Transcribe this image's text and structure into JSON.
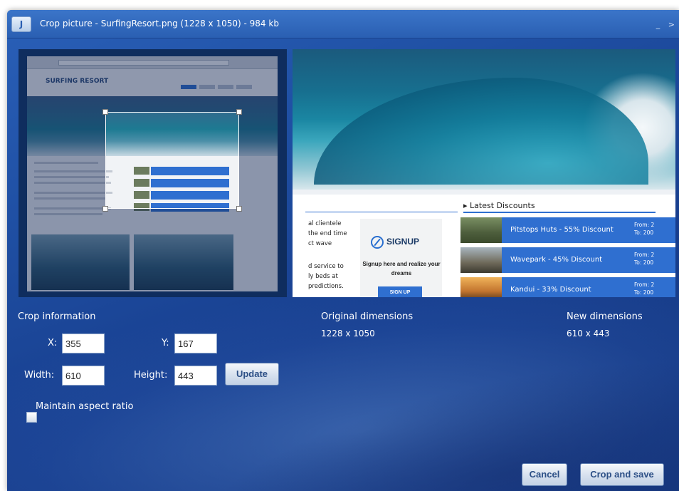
{
  "window": {
    "app_icon_letter": "J",
    "title": "Crop picture - SurfingResort.png  (1228 x 1050)  -  984 kb",
    "controls": "_ >"
  },
  "preview": {
    "site_logo": "SURFING RESORT",
    "latest_discounts": "Latest Discounts",
    "snippet_lines": [
      "al clientele",
      "the end time",
      "ct wave",
      "d service to",
      "ly beds at",
      "predictions."
    ],
    "signup_logo_text": "SIGNUP",
    "signup_tagline": "Signup here and realize your dreams",
    "signup_button": "SIGN UP",
    "deals": [
      {
        "name": "Pitstops Huts - 55% Discount",
        "from": "From: 2",
        "to": "To: 200"
      },
      {
        "name": "Wavepark - 45% Discount",
        "from": "From: 2",
        "to": "To: 200"
      },
      {
        "name": "Kandui - 33% Discount",
        "from": "From: 2",
        "to": "To: 200"
      }
    ]
  },
  "crop_info": {
    "heading": "Crop information",
    "x_label": "X:",
    "x_value": "355",
    "y_label": "Y:",
    "y_value": "167",
    "width_label": "Width:",
    "width_value": "610",
    "height_label": "Height:",
    "height_value": "443",
    "update_button": "Update",
    "aspect_label": "Maintain aspect ratio",
    "aspect_checked": false
  },
  "original": {
    "heading": "Original dimensions",
    "value": "1228 x 1050"
  },
  "new_dims": {
    "heading": "New dimensions",
    "value": "610 x 443"
  },
  "actions": {
    "cancel": "Cancel",
    "crop_save": "Crop and save"
  },
  "colors": {
    "dialog_blue": "#1f4fa3",
    "accent_blue": "#2f6fd0",
    "button_text": "#2c4f86"
  }
}
